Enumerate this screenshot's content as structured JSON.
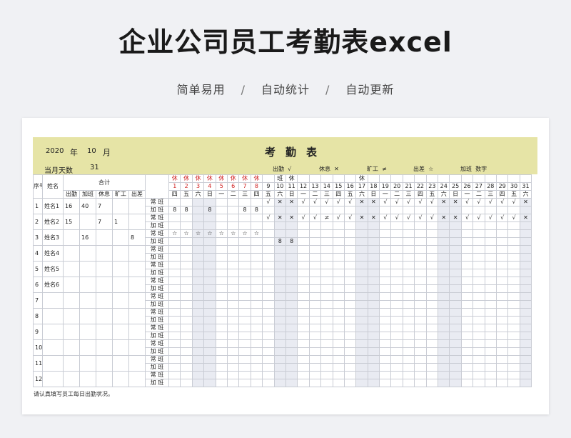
{
  "page_title": "企业公司员工考勤表excel",
  "subtitle": [
    "简单易用",
    "/",
    "自动统计",
    "/",
    "自动更新"
  ],
  "sheet": {
    "year": "2020",
    "year_label": "年",
    "month": "10",
    "month_label": "月",
    "title": "考勤表",
    "days_label": "当月天数",
    "days_value": "31",
    "legend": [
      {
        "label": "出勤",
        "symbol": "√"
      },
      {
        "label": "休息",
        "symbol": "✕"
      },
      {
        "label": "旷工",
        "symbol": "≠"
      },
      {
        "label": "出差",
        "symbol": "☆"
      },
      {
        "label": "加班",
        "symbol": "数字"
      }
    ],
    "header": {
      "seq": "序号",
      "name": "姓名",
      "total": "合计",
      "total_cols": [
        "出勤",
        "加班",
        "休息",
        "旷工",
        "出差"
      ]
    },
    "days": [
      "1",
      "2",
      "3",
      "4",
      "5",
      "6",
      "7",
      "8",
      "9",
      "10",
      "11",
      "12",
      "13",
      "14",
      "15",
      "16",
      "17",
      "18",
      "19",
      "20",
      "21",
      "22",
      "23",
      "24",
      "25",
      "26",
      "27",
      "28",
      "29",
      "30",
      "31"
    ],
    "day_marks": [
      "休",
      "休",
      "休",
      "休",
      "休",
      "休",
      "休",
      "休",
      "",
      "班",
      "休",
      "",
      "",
      "",
      "",
      "",
      "休",
      "",
      "",
      "",
      "",
      "",
      "",
      "",
      "",
      "",
      "",
      "",
      "",
      "",
      ""
    ],
    "weekdays": [
      "四",
      "五",
      "六",
      "日",
      "一",
      "二",
      "三",
      "四",
      "五",
      "六",
      "日",
      "一",
      "二",
      "三",
      "四",
      "五",
      "六",
      "日",
      "一",
      "二",
      "三",
      "四",
      "五",
      "六",
      "日",
      "一",
      "二",
      "三",
      "四",
      "五",
      "六"
    ],
    "row_types": [
      "常 班",
      "加 班"
    ],
    "employees": [
      {
        "seq": "1",
        "name": "姓名1",
        "totals": [
          "16",
          "40",
          "7",
          "",
          ""
        ],
        "regular": [
          "",
          "",
          "",
          "",
          "",
          "",
          "",
          "",
          "√",
          "✕",
          "✕",
          "√",
          "√",
          "√",
          "√",
          "√",
          "✕",
          "✕",
          "√",
          "√",
          "√",
          "√",
          "√",
          "✕",
          "✕",
          "√",
          "√",
          "√",
          "√",
          "√",
          "✕"
        ],
        "overtime": [
          "8",
          "8",
          "",
          "8",
          "",
          "",
          "8",
          "8",
          "",
          "",
          "",
          "",
          "",
          "",
          "",
          "",
          "",
          "",
          "",
          "",
          "",
          "",
          "",
          "",
          "",
          "",
          "",
          "",
          "",
          "",
          ""
        ]
      },
      {
        "seq": "2",
        "name": "姓名2",
        "totals": [
          "15",
          "",
          "7",
          "1",
          ""
        ],
        "regular": [
          "",
          "",
          "",
          "",
          "",
          "",
          "",
          "",
          "√",
          "✕",
          "✕",
          "√",
          "√",
          "≠",
          "√",
          "√",
          "✕",
          "✕",
          "√",
          "√",
          "√",
          "√",
          "√",
          "✕",
          "✕",
          "√",
          "√",
          "√",
          "√",
          "√",
          "✕"
        ],
        "overtime": [
          "",
          "",
          "",
          "",
          "",
          "",
          "",
          "",
          "",
          "",
          "",
          "",
          "",
          "",
          "",
          "",
          "",
          "",
          "",
          "",
          "",
          "",
          "",
          "",
          "",
          "",
          "",
          "",
          "",
          "",
          ""
        ]
      },
      {
        "seq": "3",
        "name": "姓名3",
        "totals": [
          "",
          "16",
          "",
          "",
          "8"
        ],
        "regular": [
          "☆",
          "☆",
          "☆",
          "☆",
          "☆",
          "☆",
          "☆",
          "☆",
          "",
          "",
          "",
          "",
          "",
          "",
          "",
          "",
          "",
          "",
          "",
          "",
          "",
          "",
          "",
          "",
          "",
          "",
          "",
          "",
          "",
          "",
          ""
        ],
        "overtime": [
          "",
          "",
          "",
          "",
          "",
          "",
          "",
          "",
          "",
          "8",
          "8",
          "",
          "",
          "",
          "",
          "",
          "",
          "",
          "",
          "",
          "",
          "",
          "",
          "",
          "",
          "",
          "",
          "",
          "",
          "",
          ""
        ]
      },
      {
        "seq": "4",
        "name": "姓名4",
        "totals": [
          "",
          "",
          "",
          "",
          ""
        ],
        "regular": [],
        "overtime": []
      },
      {
        "seq": "5",
        "name": "姓名5",
        "totals": [
          "",
          "",
          "",
          "",
          ""
        ],
        "regular": [],
        "overtime": []
      },
      {
        "seq": "6",
        "name": "姓名6",
        "totals": [
          "",
          "",
          "",
          "",
          ""
        ],
        "regular": [],
        "overtime": []
      },
      {
        "seq": "7",
        "name": "",
        "totals": [
          "",
          "",
          "",
          "",
          ""
        ],
        "regular": [],
        "overtime": []
      },
      {
        "seq": "8",
        "name": "",
        "totals": [
          "",
          "",
          "",
          "",
          ""
        ],
        "regular": [],
        "overtime": []
      },
      {
        "seq": "9",
        "name": "",
        "totals": [
          "",
          "",
          "",
          "",
          ""
        ],
        "regular": [],
        "overtime": []
      },
      {
        "seq": "10",
        "name": "",
        "totals": [
          "",
          "",
          "",
          "",
          ""
        ],
        "regular": [],
        "overtime": []
      },
      {
        "seq": "11",
        "name": "",
        "totals": [
          "",
          "",
          "",
          "",
          ""
        ],
        "regular": [],
        "overtime": []
      },
      {
        "seq": "12",
        "name": "",
        "totals": [
          "",
          "",
          "",
          "",
          ""
        ],
        "regular": [],
        "overtime": []
      }
    ],
    "footnote": "请认真填写员工每日出勤状况。"
  }
}
